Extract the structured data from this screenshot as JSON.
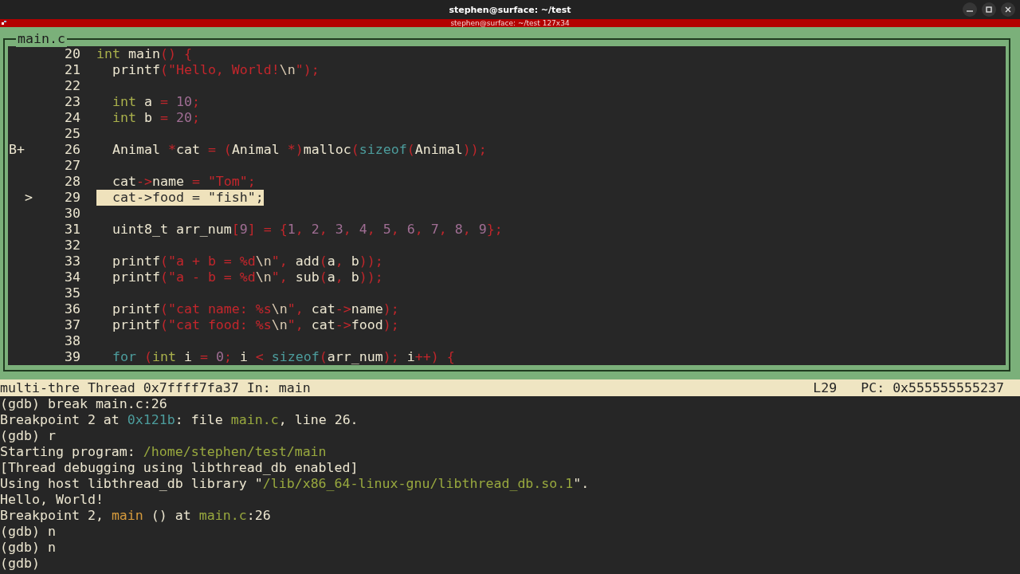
{
  "window": {
    "title": "stephen@surface: ~/test"
  },
  "tab": {
    "title": "stephen@surface: ~/test 127x34"
  },
  "source": {
    "file": "main.c",
    "lines": [
      {
        "number": "20",
        "current": false,
        "tokens": [
          {
            "text": "int",
            "kind": "keyword"
          },
          {
            "text": " main",
            "kind": "plain"
          },
          {
            "text": "() {",
            "kind": "punct"
          }
        ]
      },
      {
        "number": "21",
        "current": false,
        "tokens": [
          {
            "text": "  printf",
            "kind": "plain"
          },
          {
            "text": "(\"Hello, World!",
            "kind": "string"
          },
          {
            "text": "\\n",
            "kind": "escape"
          },
          {
            "text": "\");",
            "kind": "string"
          }
        ]
      },
      {
        "number": "22",
        "current": false
      },
      {
        "number": "23",
        "current": false,
        "tokens": [
          {
            "text": "  int",
            "kind": "keyword"
          },
          {
            "text": " a ",
            "kind": "plain"
          },
          {
            "text": "= ",
            "kind": "punct"
          },
          {
            "text": "10",
            "kind": "number"
          },
          {
            "text": ";",
            "kind": "punct"
          }
        ]
      },
      {
        "number": "24",
        "current": false,
        "tokens": [
          {
            "text": "  int",
            "kind": "keyword"
          },
          {
            "text": " b ",
            "kind": "plain"
          },
          {
            "text": "= ",
            "kind": "punct"
          },
          {
            "text": "20",
            "kind": "number"
          },
          {
            "text": ";",
            "kind": "punct"
          }
        ]
      },
      {
        "number": "25",
        "current": false
      },
      {
        "number": "26",
        "current": false,
        "marker": {
          "text": "B+",
          "kind": "breakpoint"
        },
        "tokens": [
          {
            "text": "  Animal ",
            "kind": "plain"
          },
          {
            "text": "*",
            "kind": "punct"
          },
          {
            "text": "cat ",
            "kind": "plain"
          },
          {
            "text": "= (",
            "kind": "punct"
          },
          {
            "text": "Animal ",
            "kind": "plain"
          },
          {
            "text": "*)",
            "kind": "punct"
          },
          {
            "text": "malloc",
            "kind": "plain"
          },
          {
            "text": "(",
            "kind": "punct"
          },
          {
            "text": "sizeof",
            "kind": "builtin"
          },
          {
            "text": "(",
            "kind": "punct"
          },
          {
            "text": "Animal",
            "kind": "plain"
          },
          {
            "text": "));",
            "kind": "punct"
          }
        ]
      },
      {
        "number": "27",
        "current": false
      },
      {
        "number": "28",
        "current": false,
        "tokens": [
          {
            "text": "  cat",
            "kind": "plain"
          },
          {
            "text": "->",
            "kind": "punct"
          },
          {
            "text": "name ",
            "kind": "plain"
          },
          {
            "text": "= ",
            "kind": "punct"
          },
          {
            "text": "\"Tom\";",
            "kind": "string"
          }
        ]
      },
      {
        "number": "29",
        "current": true,
        "marker": {
          "text": ">",
          "kind": "pc"
        },
        "tokens": [
          {
            "text": "  cat",
            "kind": "plain"
          },
          {
            "text": "->",
            "kind": "punct"
          },
          {
            "text": "food ",
            "kind": "plain"
          },
          {
            "text": "= ",
            "kind": "punct"
          },
          {
            "text": "\"fish\";",
            "kind": "string"
          }
        ]
      },
      {
        "number": "30",
        "current": false
      },
      {
        "number": "31",
        "current": false,
        "tokens": [
          {
            "text": "  uint8_t arr_num",
            "kind": "plain"
          },
          {
            "text": "[",
            "kind": "punct"
          },
          {
            "text": "9",
            "kind": "number"
          },
          {
            "text": "] = {",
            "kind": "punct"
          },
          {
            "text": "1",
            "kind": "number"
          },
          {
            "text": ", ",
            "kind": "punct"
          },
          {
            "text": "2",
            "kind": "number"
          },
          {
            "text": ", ",
            "kind": "punct"
          },
          {
            "text": "3",
            "kind": "number"
          },
          {
            "text": ", ",
            "kind": "punct"
          },
          {
            "text": "4",
            "kind": "number"
          },
          {
            "text": ", ",
            "kind": "punct"
          },
          {
            "text": "5",
            "kind": "number"
          },
          {
            "text": ", ",
            "kind": "punct"
          },
          {
            "text": "6",
            "kind": "number"
          },
          {
            "text": ", ",
            "kind": "punct"
          },
          {
            "text": "7",
            "kind": "number"
          },
          {
            "text": ", ",
            "kind": "punct"
          },
          {
            "text": "8",
            "kind": "number"
          },
          {
            "text": ", ",
            "kind": "punct"
          },
          {
            "text": "9",
            "kind": "number"
          },
          {
            "text": "};",
            "kind": "punct"
          }
        ]
      },
      {
        "number": "32",
        "current": false
      },
      {
        "number": "33",
        "current": false,
        "tokens": [
          {
            "text": "  printf",
            "kind": "plain"
          },
          {
            "text": "(\"a + b = %d",
            "kind": "string"
          },
          {
            "text": "\\n",
            "kind": "escape"
          },
          {
            "text": "\", ",
            "kind": "punct"
          },
          {
            "text": "add",
            "kind": "plain"
          },
          {
            "text": "(",
            "kind": "punct"
          },
          {
            "text": "a",
            "kind": "plain"
          },
          {
            "text": ", ",
            "kind": "punct"
          },
          {
            "text": "b",
            "kind": "plain"
          },
          {
            "text": "));",
            "kind": "punct"
          }
        ]
      },
      {
        "number": "34",
        "current": false,
        "tokens": [
          {
            "text": "  printf",
            "kind": "plain"
          },
          {
            "text": "(\"a - b = %d",
            "kind": "string"
          },
          {
            "text": "\\n",
            "kind": "escape"
          },
          {
            "text": "\", ",
            "kind": "punct"
          },
          {
            "text": "sub",
            "kind": "plain"
          },
          {
            "text": "(",
            "kind": "punct"
          },
          {
            "text": "a",
            "kind": "plain"
          },
          {
            "text": ", ",
            "kind": "punct"
          },
          {
            "text": "b",
            "kind": "plain"
          },
          {
            "text": "));",
            "kind": "punct"
          }
        ]
      },
      {
        "number": "35",
        "current": false
      },
      {
        "number": "36",
        "current": false,
        "tokens": [
          {
            "text": "  printf",
            "kind": "plain"
          },
          {
            "text": "(\"cat name: %s",
            "kind": "string"
          },
          {
            "text": "\\n",
            "kind": "escape"
          },
          {
            "text": "\", ",
            "kind": "punct"
          },
          {
            "text": "cat",
            "kind": "plain"
          },
          {
            "text": "->",
            "kind": "punct"
          },
          {
            "text": "name",
            "kind": "plain"
          },
          {
            "text": ");",
            "kind": "punct"
          }
        ]
      },
      {
        "number": "37",
        "current": false,
        "tokens": [
          {
            "text": "  printf",
            "kind": "plain"
          },
          {
            "text": "(\"cat food: %s",
            "kind": "string"
          },
          {
            "text": "\\n",
            "kind": "escape"
          },
          {
            "text": "\", ",
            "kind": "punct"
          },
          {
            "text": "cat",
            "kind": "plain"
          },
          {
            "text": "->",
            "kind": "punct"
          },
          {
            "text": "food",
            "kind": "plain"
          },
          {
            "text": ");",
            "kind": "punct"
          }
        ]
      },
      {
        "number": "38",
        "current": false
      },
      {
        "number": "39",
        "current": false,
        "tokens": [
          {
            "text": "  for",
            "kind": "builtin"
          },
          {
            "text": " (",
            "kind": "punct"
          },
          {
            "text": "int",
            "kind": "keyword"
          },
          {
            "text": " i ",
            "kind": "plain"
          },
          {
            "text": "= ",
            "kind": "punct"
          },
          {
            "text": "0",
            "kind": "number"
          },
          {
            "text": "; ",
            "kind": "punct"
          },
          {
            "text": "i ",
            "kind": "plain"
          },
          {
            "text": "< ",
            "kind": "punct"
          },
          {
            "text": "sizeof",
            "kind": "builtin"
          },
          {
            "text": "(",
            "kind": "punct"
          },
          {
            "text": "arr_num",
            "kind": "plain"
          },
          {
            "text": "); ",
            "kind": "punct"
          },
          {
            "text": "i",
            "kind": "plain"
          },
          {
            "text": "++) {",
            "kind": "punct"
          }
        ]
      }
    ]
  },
  "status_bar": {
    "thread": "multi-thre Thread 0x7ffff7fa37 In: main",
    "line": "L29",
    "pc": "PC: 0x555555555237"
  },
  "console": [
    [
      {
        "text": "(gdb) break main.c:26",
        "kind": "plain"
      }
    ],
    [
      {
        "text": "Breakpoint 2 at ",
        "kind": "plain"
      },
      {
        "text": "0x121b",
        "kind": "address"
      },
      {
        "text": ": file ",
        "kind": "plain"
      },
      {
        "text": "main.c",
        "kind": "path"
      },
      {
        "text": ", line 26.",
        "kind": "plain"
      }
    ],
    [
      {
        "text": "(gdb) r",
        "kind": "plain"
      }
    ],
    [
      {
        "text": "Starting program: ",
        "kind": "plain"
      },
      {
        "text": "/home/stephen/test/main",
        "kind": "path"
      }
    ],
    [
      {
        "text": "[Thread debugging using libthread_db enabled]",
        "kind": "plain"
      }
    ],
    [
      {
        "text": "Using host libthread_db library \"",
        "kind": "plain"
      },
      {
        "text": "/lib/x86_64-linux-gnu/libthread_db.so.1",
        "kind": "path"
      },
      {
        "text": "\".",
        "kind": "plain"
      }
    ],
    [
      {
        "text": "Hello, World!",
        "kind": "plain"
      }
    ],
    [
      {
        "text": "Breakpoint 2, ",
        "kind": "plain"
      },
      {
        "text": "main",
        "kind": "function"
      },
      {
        "text": " () at ",
        "kind": "plain"
      },
      {
        "text": "main.c",
        "kind": "path"
      },
      {
        "text": ":26",
        "kind": "plain"
      }
    ],
    [
      {
        "text": "(gdb) n",
        "kind": "plain"
      }
    ],
    [
      {
        "text": "(gdb) n",
        "kind": "plain"
      }
    ],
    [
      {
        "text": "(gdb)",
        "kind": "plain"
      }
    ]
  ]
}
